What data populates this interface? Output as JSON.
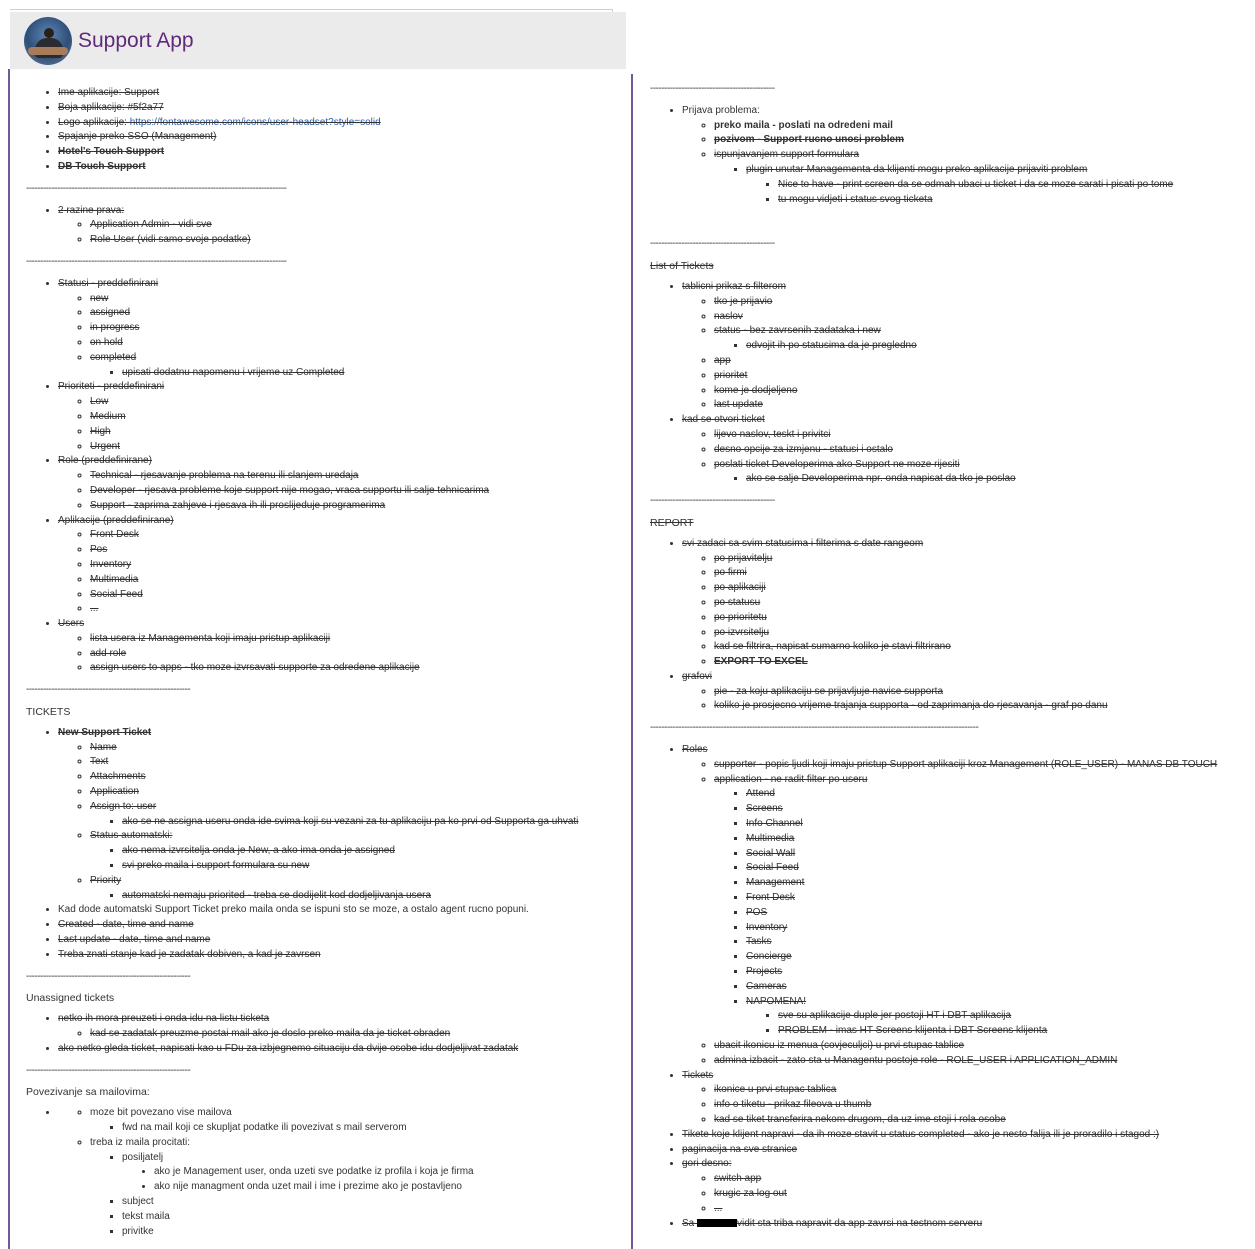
{
  "header": {
    "title": "Support App"
  },
  "left": {
    "basics": [
      "Ime aplikacije: Support",
      "Boja aplikacije: #5f2a77"
    ],
    "logo_label": "Logo aplikacije: ",
    "logo_url": "https://fontawesome.com/icons/user-headset?style=solid",
    "basics2": [
      "Spajanje preko SSO (Management)"
    ],
    "basics_bold": [
      "Hotel's Touch Support",
      "DB Touch Support"
    ],
    "sep_short": "----------------------------------------------------------",
    "sep_long": "--------------------------------------------------------------------------------------------",
    "rights": {
      "label": "2 razine prava:",
      "items": [
        "Application Admin - vidi sve",
        "Role User (vidi samo svoje podatke)"
      ]
    },
    "statusi": {
      "label": "Statusi - preddefinirani",
      "items": [
        "new",
        "assigned",
        "in progress",
        "on hold",
        "completed"
      ],
      "completed_note": "upisati dodatnu napomenu i vrijeme uz Completed"
    },
    "prioriteti": {
      "label": "Prioriteti - preddefinirani",
      "items": [
        "Low",
        "Medium",
        "High",
        "Urgent"
      ]
    },
    "role": {
      "label": "Role (preddefinirane)",
      "items": [
        "Technical - rjesavanje problema na terenu ili slanjem uredaja",
        "Developer - rjesava probleme koje support nije mogao, vraca supportu ili salje tehnicarima",
        "Support - zaprima zahjeve i rjesava ih ili proslijeduje programerima"
      ]
    },
    "aplikacije": {
      "label": "Aplikacije (preddefinirane)",
      "items": [
        "Front Desk",
        "Pos",
        "Inventory",
        "Multimedia",
        "Social Feed",
        "..."
      ]
    },
    "users": {
      "label": "Users",
      "items": [
        "lista usera iz Managementa koji imaju pristup aplikaciji",
        "add role",
        "assign users to apps - tko moze izvrsavati supporte za odredene aplikacije"
      ]
    },
    "tickets_heading": "TICKETS",
    "new_ticket": {
      "label": "New Support Ticket",
      "fields": [
        "Name",
        "Text",
        "Attachments",
        "Application"
      ],
      "assign_label": "Assign to: user",
      "assign_note": "ako se ne assigna useru onda ide svima koji su vezani za tu aplikaciju pa ko prvi od Supporta ga uhvati",
      "status_label": "Status automatski:",
      "status_notes": [
        "ako nema izvrsitelja onda je New, a ako ima onda je assigned",
        "svi preko maila i support formulara su new"
      ],
      "priority_label": "Priority",
      "priority_note": "automatski nemaju priorited - treba se dodijelit kod dodjeljivanja usera"
    },
    "ticket_notes_plain": "Kad dode automatski Support Ticket preko maila onda se ispuni sto se moze, a ostalo agent rucno popuni.",
    "ticket_notes_struck": [
      "Created - date, time and name",
      "Last update - date, time and name",
      "Treba znati stanje kad je zadatak dobiven, a kad je zavrsen"
    ],
    "unassigned_heading": "Unassigned tickets",
    "unassigned": {
      "item1": "netko ih mora preuzeti i onda idu na listu ticketa",
      "item1_sub": "kad se zadatak preuzme postai mail ako je doslo preko maila da je ticket obraden",
      "item2": "ako netko gleda ticket, napisati kao u FDu za izbjegnemo situaciju da dvije osobe idu dodjeljivat zadatak"
    },
    "mail_heading": "Povezivanje  sa mailovima:",
    "mail": {
      "item1": "moze bit povezano vise mailova",
      "item1_sub": "fwd na mail koji ce skupljat podatke ili povezivat s mail serverom",
      "item2": "treba iz maila procitati:",
      "sender": "posiljatelj",
      "sender_notes": [
        "ako je Management user, onda uzeti sve podatke iz profila i koja je firma",
        "ako nije managment onda uzet mail i ime i prezime ako je postavljeno"
      ],
      "fields": [
        "subject",
        "tekst maila",
        "privitke"
      ]
    }
  },
  "right": {
    "sep_top": "--------------------------------------------",
    "prijava": {
      "label": "Prijava problema:",
      "mail": "preko maila - poslati na odredeni mail",
      "poziv": "pozivom - Support rucno unosi problem",
      "formular": "ispunjavanjem support formulara",
      "plugin": "plugin unutar Managementa da klijenti mogu preko aplikacije prijaviti problem",
      "plugin_notes": [
        "Nice to have - print screen da se odmah ubaci u ticket i da se moze sarati i pisati po tome",
        "tu mogu vidjeti i status svog ticketa"
      ]
    },
    "sep": "--------------------------------------------",
    "list_heading": "List of Tickets",
    "list": {
      "table_label": "tablicni prikaz s filterom",
      "table_items_a": [
        "tko je prijavio",
        "naslov",
        "status - bez zavrsenih zadataka i new"
      ],
      "status_note": "odvojit ih po statusima da je pregledno",
      "table_items_b": [
        "app",
        "prioritet",
        "kome je dodjeljeno",
        "last update"
      ],
      "open_label": "kad se otvori ticket",
      "open_items": [
        "lijevo naslov, teskt i privitci",
        "desno opcije za izmjenu - statusi i ostalo",
        "poslati ticket Developerima ako Support ne moze rijesiti"
      ],
      "open_note": "ako se salje Developerima npr. onda napisat da tko je poslao"
    },
    "report_heading": "REPORT",
    "report": {
      "all_label": "svi zadaci sa svim statusima i filterima s date rangeom",
      "filters": [
        "po prijavitelju",
        "po firmi",
        "po aplikaciji",
        "po statusu",
        "po prioritetu",
        "po izvrsitelju",
        "kad se filtrira, napisat sumarno koliko je stavi filtrirano"
      ],
      "export": "EXPORT TO EXCEL",
      "graf_label": "grafovi",
      "graf_items": [
        "pie - za koju aplikaciju se prijavljuje navise supporta",
        "koliko je prosjecno vrijeme trajanja supporta - od zaprimanja do rjesavanja - graf po danu"
      ]
    },
    "sep_long": "--------------------------------------------------------------------------------------------------------------------",
    "roles": {
      "label": "Roles",
      "supporter": "supporter - popis ljudi koji imaju pristup Support aplikaciji kroz Management (ROLE_USER) - MANAS DB TOUCH",
      "application": "application - ne radit filter po useru",
      "apps": [
        "Attend",
        "Screens",
        "Info Channel",
        "Multimedia",
        "Social Wall",
        "Social Feed",
        "Management",
        "Front Desk",
        "POS",
        "Inventory",
        "Tasks",
        "Concierge",
        "Projects",
        "Cameras",
        "NAPOMENA!"
      ],
      "napomena": [
        "sve su aplikacije duple jer postoji HT i DBT aplikacija",
        "PROBLEM - imas HT Screens klijenta i DBT Screens klijenta"
      ],
      "tail": [
        "ubacit ikonicu iz menua (covjeculjci) u prvi stupac tablice",
        "admina izbacit - zato sta u Managentu postoje role - ROLE_USER i APPLICATION_ADMIN"
      ]
    },
    "tickets": {
      "label": "Tickets",
      "items": [
        "ikonice u prvi stupac tablica",
        "info o tiketu - prikaz fileova u thumb",
        "kad se tiket transferira nekom drugom, da uz ime stoji i rola osobe"
      ]
    },
    "misc": [
      "Tikete koje klijent napravi - da ih moze stavit u status completed - ako je nesto falija ili je proradilo i stagod :)",
      "paginacija na sve stranice"
    ],
    "gori": {
      "label": "gori desno:",
      "items": [
        "switch app",
        "krugic za log out",
        "..."
      ]
    },
    "last_prefix": "Sa ",
    "last_suffix": "vidit sta triba napravit da app zavrsi na testnom serveru"
  }
}
